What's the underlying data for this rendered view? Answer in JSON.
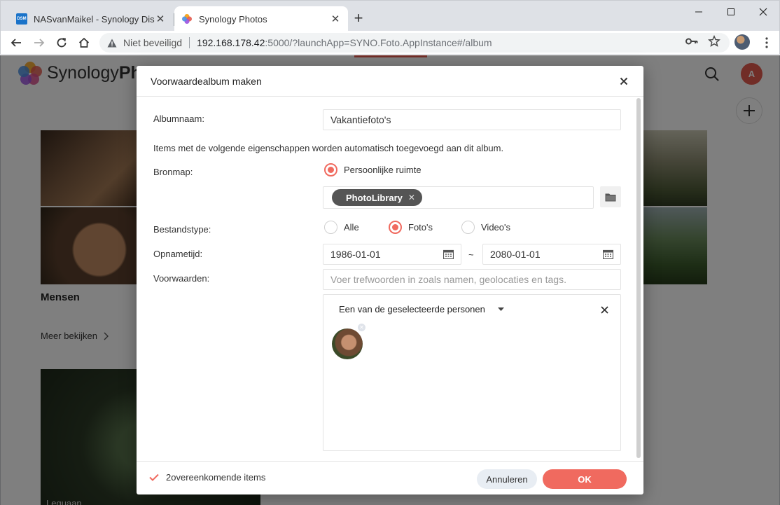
{
  "browser": {
    "tabs": [
      {
        "title": "NASvanMaikel - Synology DiskSt",
        "favicon_text": "DSM",
        "close": "✕"
      },
      {
        "title": "Synology Photos",
        "close": "✕"
      }
    ],
    "new_tab": "+",
    "security_label": "Niet beveiligd",
    "url_host": "192.168.178.42",
    "url_path": ":5000/?launchApp=SYNO.Foto.AppInstance#/album"
  },
  "page": {
    "brand": "Synology",
    "brand_bold": "Ph",
    "user_initial": "A",
    "section_title": "Mensen",
    "more_link": "Meer bekijken",
    "album_caption": "Leguaan"
  },
  "dialog": {
    "title": "Voorwaardealbum maken",
    "album_name_label": "Albumnaam:",
    "album_name_value": "Vakantiefoto's",
    "info_text": "Items met de volgende eigenschappen worden automatisch toegevoegd aan dit album.",
    "source_label": "Bronmap:",
    "source_option": "Persoonlijke ruimte",
    "folder_chip": "PhotoLibrary",
    "filetype_label": "Bestandstype:",
    "filetype_options": [
      "Alle",
      "Foto's",
      "Video's"
    ],
    "filetype_selected": "Foto's",
    "time_label": "Opnametijd:",
    "date_from": "1986-01-01",
    "date_sep": "~",
    "date_to": "2080-01-01",
    "conditions_label": "Voorwaarden:",
    "conditions_placeholder": "Voer trefwoorden in zoals namen, geolocaties en tags.",
    "condition_type": "Een van de geselecteerde personen",
    "status_text": "2overeenkomende items",
    "cancel_label": "Annuleren",
    "ok_label": "OK"
  },
  "colors": {
    "accent": "#f06a5f",
    "overlay": "rgba(0,0,0,0.5)"
  }
}
